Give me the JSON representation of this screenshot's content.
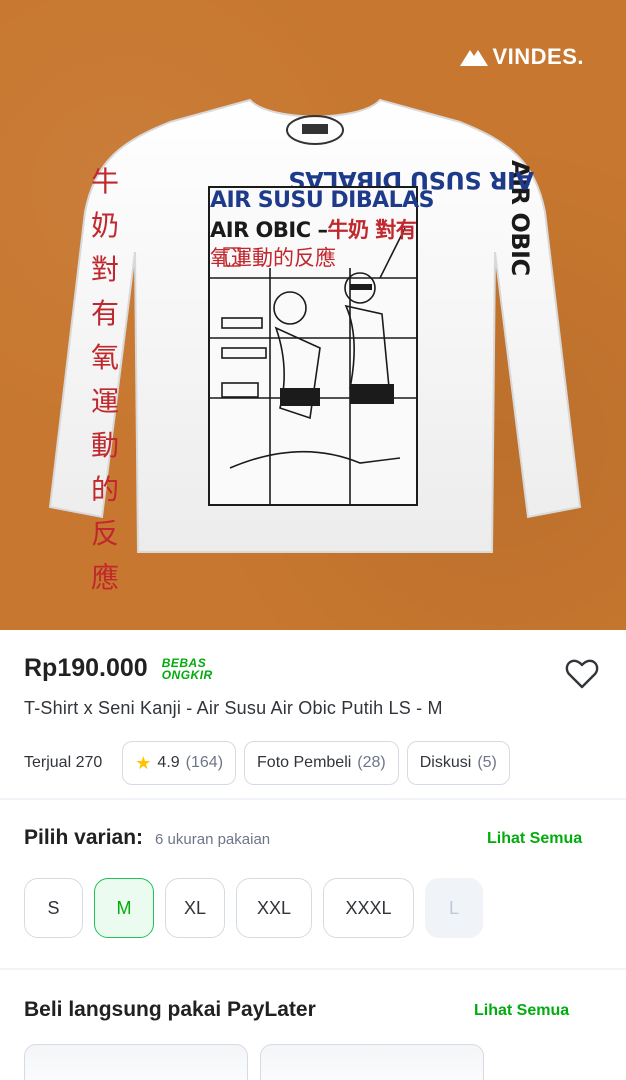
{
  "hero": {
    "brand": "VINDES.",
    "print": {
      "line1": "AIR SUSU DIBALAS",
      "line2_black": "AIR OBIC –",
      "line2_red": "牛奶 對有",
      "line3": "氧運動的反應",
      "sleeve_left": "牛奶對有氧運動的反應",
      "sleeve_right_blue": "AIR SUSU DIBALAS ",
      "sleeve_right_black": "AIR OBIC"
    }
  },
  "product": {
    "price": "Rp190.000",
    "badge_line1": "BEBAS",
    "badge_line2": "ONGKIR",
    "title": "T-Shirt x Seni Kanji - Air Susu Air Obic Putih LS - M",
    "sold": "Terjual 270",
    "rating": "4.9",
    "rating_count": "(164)",
    "photos_label": "Foto Pembeli",
    "photos_count": "(28)",
    "discussion_label": "Diskusi",
    "discussion_count": "(5)"
  },
  "variant": {
    "title": "Pilih varian:",
    "subtitle": "6 ukuran pakaian",
    "see_all": "Lihat Semua",
    "options": [
      {
        "label": "S",
        "state": "normal"
      },
      {
        "label": "M",
        "state": "selected"
      },
      {
        "label": "XL",
        "state": "normal"
      },
      {
        "label": "XXL",
        "state": "normal"
      },
      {
        "label": "XXXL",
        "state": "normal"
      },
      {
        "label": "L",
        "state": "disabled"
      }
    ]
  },
  "paylater": {
    "title": "Beli langsung pakai PayLater",
    "see_all": "Lihat Semua"
  },
  "colors": {
    "hero_bg": "#c7772f",
    "accent_green": "#03ac0e",
    "print_blue": "#1e3a8a",
    "print_red": "#c0282d"
  }
}
